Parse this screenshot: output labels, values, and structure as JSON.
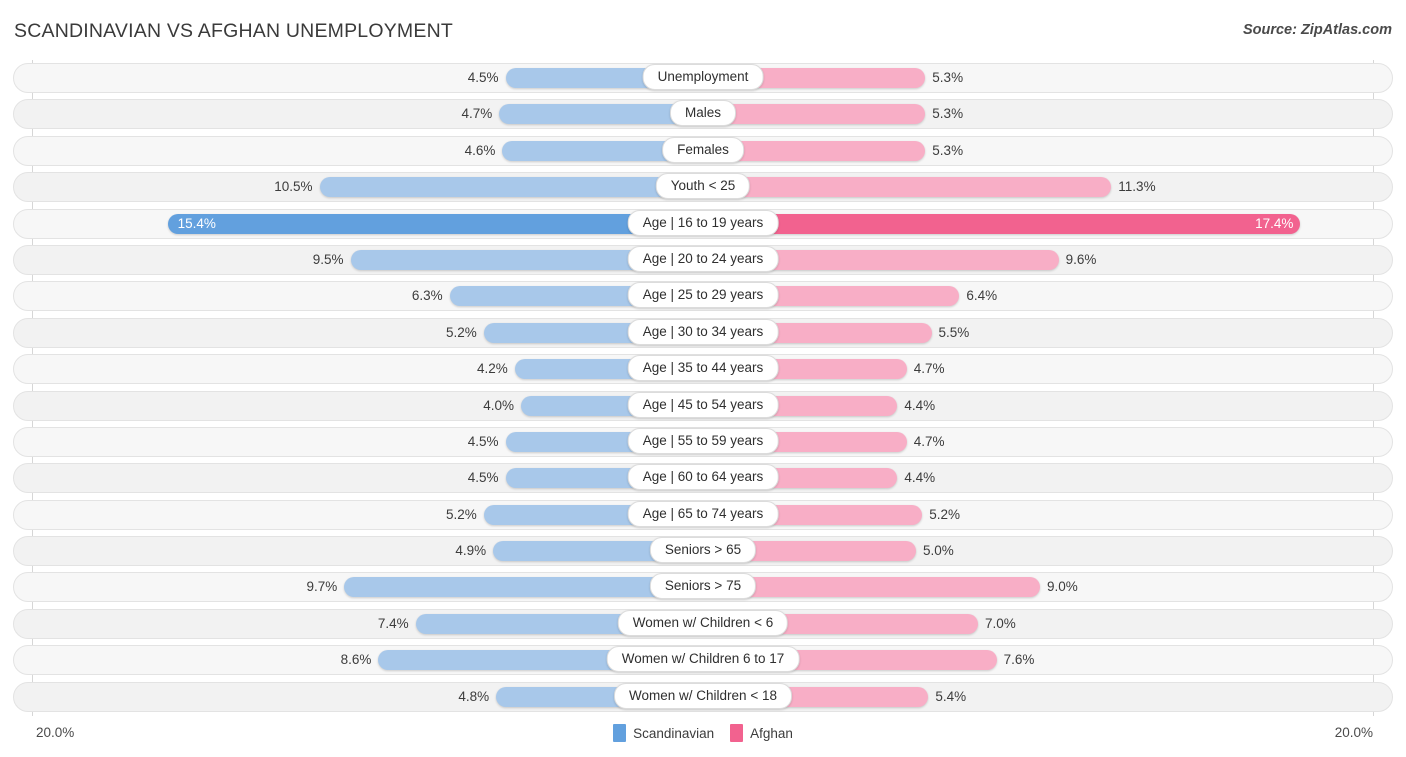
{
  "header": {
    "title": "SCANDINAVIAN VS AFGHAN UNEMPLOYMENT",
    "source": "Source: ZipAtlas.com"
  },
  "footer": {
    "axis_left": "20.0%",
    "axis_right": "20.0%",
    "legend": [
      {
        "label": "Scandinavian",
        "color": "#62a0de"
      },
      {
        "label": "Afghan",
        "color": "#f2628f"
      }
    ]
  },
  "colors": {
    "left_bar": "#a8c8ea",
    "left_bar_highlight": "#62a0de",
    "right_bar": "#f8aec6",
    "right_bar_highlight": "#f2628f",
    "row_track": "#f7f7f7",
    "axis_line": "#d6d6d6"
  },
  "chart_data": {
    "type": "bar",
    "subtype": "diverging-tornado",
    "title": "SCANDINAVIAN VS AFGHAN UNEMPLOYMENT",
    "xlabel": "",
    "ylabel": "",
    "xlim": [
      20.0,
      20.0
    ],
    "axis_max_left": 20.0,
    "axis_max_right": 20.0,
    "unit": "%",
    "grid": false,
    "legend_position": "bottom-center",
    "categories": [
      "Unemployment",
      "Males",
      "Females",
      "Youth < 25",
      "Age | 16 to 19 years",
      "Age | 20 to 24 years",
      "Age | 25 to 29 years",
      "Age | 30 to 34 years",
      "Age | 35 to 44 years",
      "Age | 45 to 54 years",
      "Age | 55 to 59 years",
      "Age | 60 to 64 years",
      "Age | 65 to 74 years",
      "Seniors > 65",
      "Seniors > 75",
      "Women w/ Children < 6",
      "Women w/ Children 6 to 17",
      "Women w/ Children < 18"
    ],
    "series": [
      {
        "name": "Scandinavian",
        "side": "left",
        "color": "#a8c8ea",
        "values": [
          4.5,
          4.7,
          4.6,
          10.5,
          15.4,
          9.5,
          6.3,
          5.2,
          4.2,
          4.0,
          4.5,
          4.5,
          5.2,
          4.9,
          9.7,
          7.4,
          8.6,
          4.8
        ],
        "labels": [
          "4.5%",
          "4.7%",
          "4.6%",
          "10.5%",
          "15.4%",
          "9.5%",
          "6.3%",
          "5.2%",
          "4.2%",
          "4.0%",
          "4.5%",
          "4.5%",
          "5.2%",
          "4.9%",
          "9.7%",
          "7.4%",
          "8.6%",
          "4.8%"
        ]
      },
      {
        "name": "Afghan",
        "side": "right",
        "color": "#f8aec6",
        "values": [
          5.3,
          5.3,
          5.3,
          11.3,
          17.4,
          9.6,
          6.4,
          5.5,
          4.7,
          4.4,
          4.7,
          4.4,
          5.2,
          5.0,
          9.0,
          7.0,
          7.6,
          5.4
        ],
        "labels": [
          "5.3%",
          "5.3%",
          "5.3%",
          "11.3%",
          "17.4%",
          "9.6%",
          "6.4%",
          "5.5%",
          "4.7%",
          "4.4%",
          "4.7%",
          "4.4%",
          "5.2%",
          "5.0%",
          "9.0%",
          "7.0%",
          "7.6%",
          "5.4%"
        ]
      }
    ],
    "highlighted_category": "Age | 16 to 19 years"
  }
}
